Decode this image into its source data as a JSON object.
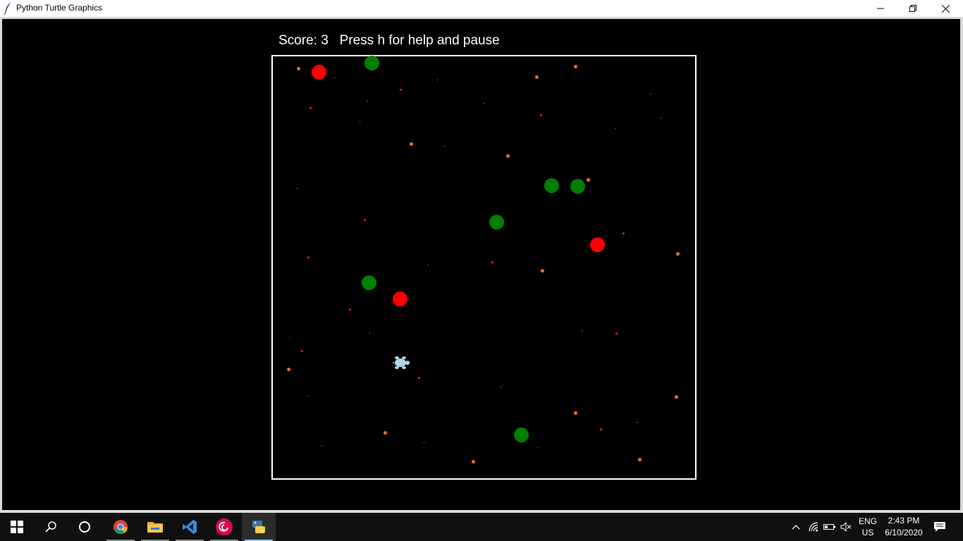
{
  "window": {
    "title": "Python Turtle Graphics",
    "minimize_glyph": "—",
    "maximize_glyph": "❐",
    "close_glyph": "✕"
  },
  "game": {
    "score_text": "Score: 3   Press h for help and pause",
    "colors": {
      "background": "#000000",
      "border": "#ffffff",
      "food": "#ff0000",
      "enemy": "#008000",
      "orange_dot": "#f07020",
      "red_particle": "#c21f0c",
      "turtle": "#add8e6"
    }
  },
  "taskbar": {
    "apps": [
      {
        "name": "start",
        "icon": "windows-icon"
      },
      {
        "name": "search",
        "icon": "search-icon"
      },
      {
        "name": "cortana",
        "icon": "cortana-icon"
      },
      {
        "name": "chrome",
        "icon": "chrome-icon"
      },
      {
        "name": "file-explorer",
        "icon": "folder-icon"
      },
      {
        "name": "vscode",
        "icon": "vscode-icon"
      },
      {
        "name": "debian",
        "icon": "debian-icon"
      },
      {
        "name": "python",
        "icon": "python-icon"
      }
    ],
    "lang": "ENG",
    "region": "US",
    "time": "2:43 PM",
    "date": "6/10/2020"
  }
}
